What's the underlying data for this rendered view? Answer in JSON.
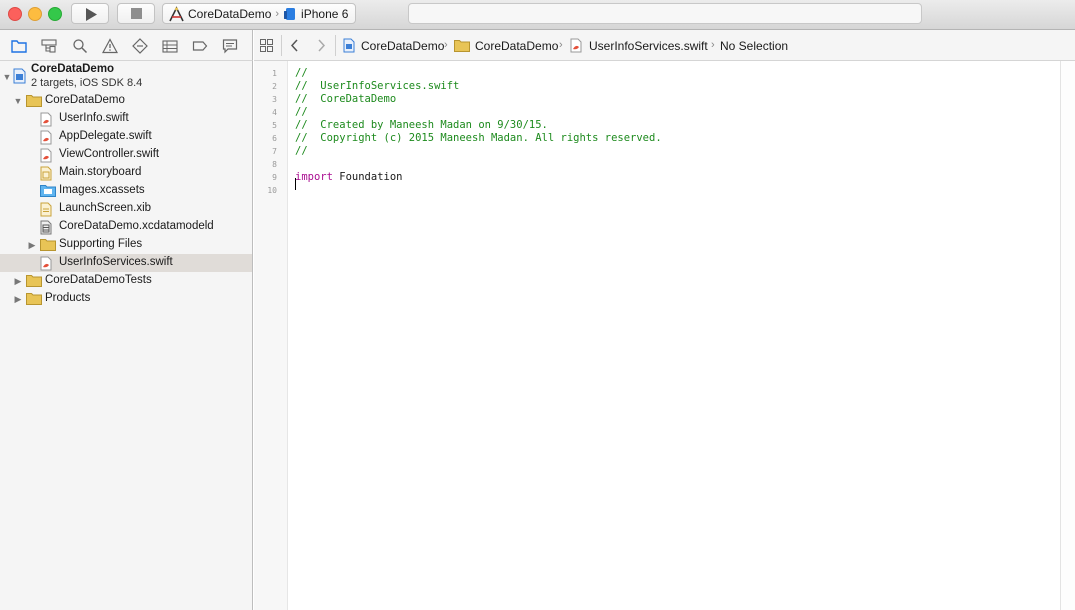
{
  "window": {
    "scheme_name": "CoreDataDemo",
    "destination": "iPhone 6",
    "activity_text": ""
  },
  "navigator": {
    "project": {
      "name": "CoreDataDemo",
      "subtitle": "2 targets, iOS SDK 8.4"
    },
    "items": [
      {
        "label": "CoreDataDemo",
        "type": "folder",
        "level": 1,
        "disclosure": "open"
      },
      {
        "label": "UserInfo.swift",
        "type": "swift",
        "level": 2
      },
      {
        "label": "AppDelegate.swift",
        "type": "swift",
        "level": 2
      },
      {
        "label": "ViewController.swift",
        "type": "swift",
        "level": 2
      },
      {
        "label": "Main.storyboard",
        "type": "storyboard",
        "level": 2
      },
      {
        "label": "Images.xcassets",
        "type": "xcassets",
        "level": 2
      },
      {
        "label": "LaunchScreen.xib",
        "type": "xib",
        "level": 2
      },
      {
        "label": "CoreDataDemo.xcdatamodeld",
        "type": "datamodel",
        "level": 2
      },
      {
        "label": "Supporting Files",
        "type": "folder",
        "level": 2,
        "disclosure": "closed"
      },
      {
        "label": "UserInfoServices.swift",
        "type": "swift",
        "level": 2,
        "selected": true
      },
      {
        "label": "CoreDataDemoTests",
        "type": "folder",
        "level": 1,
        "disclosure": "closed"
      },
      {
        "label": "Products",
        "type": "folder",
        "level": 1,
        "disclosure": "closed"
      }
    ]
  },
  "jumpbar": {
    "project": "CoreDataDemo",
    "group": "CoreDataDemo",
    "file": "UserInfoServices.swift",
    "symbol": "No Selection"
  },
  "editor": {
    "lines": [
      {
        "n": "1",
        "text": "//",
        "kind": "comment"
      },
      {
        "n": "2",
        "text": "//  UserInfoServices.swift",
        "kind": "comment"
      },
      {
        "n": "3",
        "text": "//  CoreDataDemo",
        "kind": "comment"
      },
      {
        "n": "4",
        "text": "//",
        "kind": "comment"
      },
      {
        "n": "5",
        "text": "//  Created by Maneesh Madan on 9/30/15.",
        "kind": "comment"
      },
      {
        "n": "6",
        "text": "//  Copyright (c) 2015 Maneesh Madan. All rights reserved.",
        "kind": "comment"
      },
      {
        "n": "7",
        "text": "//",
        "kind": "comment"
      },
      {
        "n": "8",
        "text": "",
        "kind": "plain"
      },
      {
        "n": "9",
        "keyword": "import",
        "text": " Foundation",
        "kind": "import"
      },
      {
        "n": "10",
        "text": "",
        "kind": "plain"
      }
    ]
  },
  "colors": {
    "comment": "#1d8a1d",
    "keyword": "#aa0d91",
    "folder": "#e8c456",
    "swift": "#e4503a"
  }
}
